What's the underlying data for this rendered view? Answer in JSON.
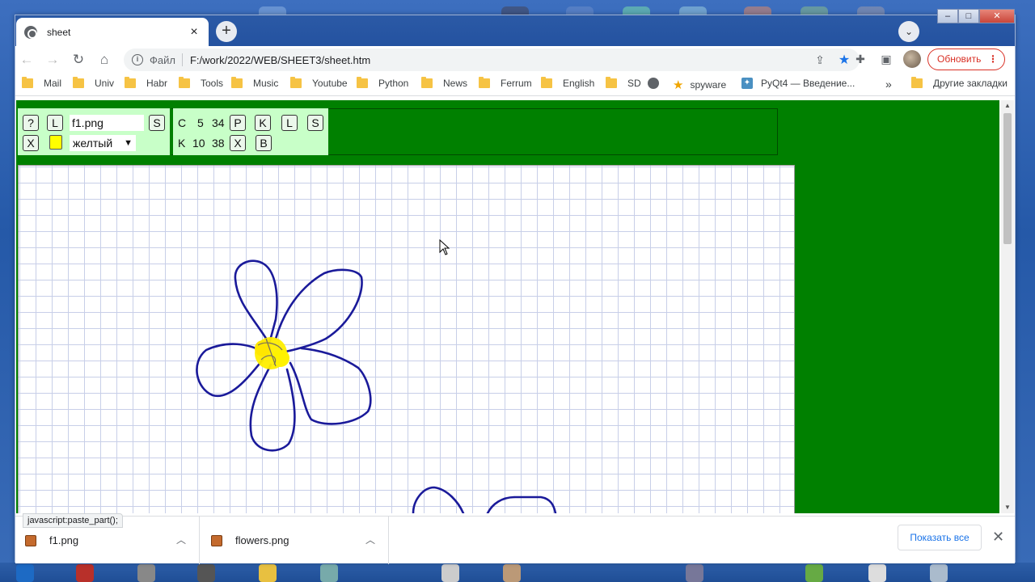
{
  "browser": {
    "tab": {
      "title": "sheet",
      "close": "×"
    },
    "new_tab": "+",
    "tab_search": "⌄",
    "window_controls": {
      "minimize": "–",
      "maximize": "□",
      "close": "✕"
    },
    "nav": {
      "back": "←",
      "forward": "→",
      "reload": "↻",
      "home": "⌂"
    },
    "address": {
      "scheme": "Файл",
      "url": "F:/work/2022/WEB/SHEET3/sheet.htm"
    },
    "update_button": "Обновить",
    "menu": "⋮"
  },
  "bookmarks": [
    {
      "label": "Mail",
      "icon": "folder-icon"
    },
    {
      "label": "Univ",
      "icon": "folder-icon"
    },
    {
      "label": "Habr",
      "icon": "folder-icon"
    },
    {
      "label": "Tools",
      "icon": "folder-icon"
    },
    {
      "label": "Music",
      "icon": "folder-icon"
    },
    {
      "label": "Youtube",
      "icon": "folder-icon"
    },
    {
      "label": "Python",
      "icon": "folder-icon"
    },
    {
      "label": "News",
      "icon": "folder-icon"
    },
    {
      "label": "Ferrum",
      "icon": "folder-icon"
    },
    {
      "label": "English",
      "icon": "folder-icon"
    },
    {
      "label": "SD",
      "icon": "folder-icon"
    },
    {
      "label": "",
      "icon": "globe-icon"
    },
    {
      "label": "spyware",
      "icon": "star-icon"
    },
    {
      "label": "PyQt4 — Введение...",
      "icon": "pyqt-icon"
    }
  ],
  "bookmarks_overflow": "»",
  "other_bookmarks": "Другие закладки",
  "panel": {
    "help": "?",
    "load": "L",
    "filename": "f1.png",
    "save": "S",
    "clear": "X",
    "color_value": "#ffff00",
    "color_name": "желтый",
    "row1": {
      "label": "C",
      "a": "5",
      "b": "34",
      "btn1": "P",
      "btn2": "K",
      "btn3": "L",
      "btn4": "S"
    },
    "row2": {
      "label": "K",
      "a": "10",
      "b": "38",
      "btn1": "X",
      "btn2": "B"
    }
  },
  "drawing": {
    "stroke_color": "#1a1a9a",
    "center_color": "#ffee00"
  },
  "status_tip": "javascript:paste_part();",
  "downloads": {
    "items": [
      "f1.png",
      "flowers.png"
    ],
    "show_all": "Показать все",
    "close": "✕"
  }
}
